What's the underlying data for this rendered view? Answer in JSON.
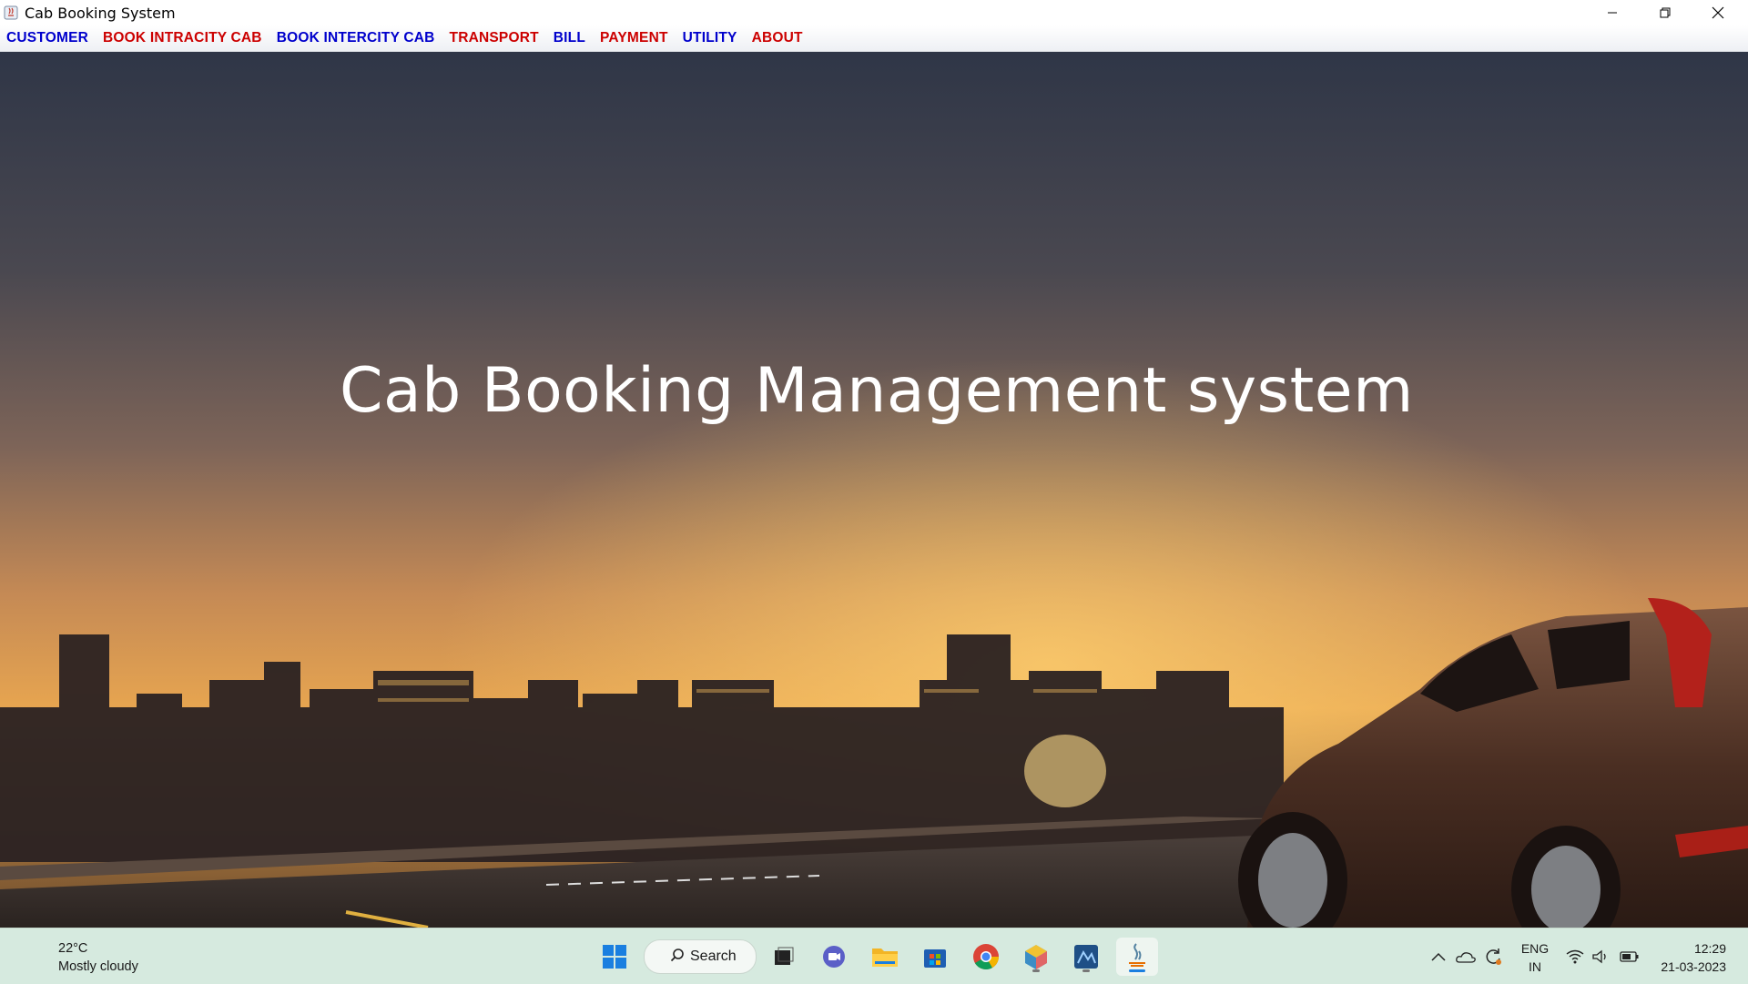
{
  "window": {
    "title": "Cab Booking System"
  },
  "menu": [
    {
      "label": "CUSTOMER",
      "color": "#0000cc"
    },
    {
      "label": "BOOK INTRACITY CAB",
      "color": "#cc0000"
    },
    {
      "label": "BOOK INTERCITY CAB",
      "color": "#0000cc"
    },
    {
      "label": "TRANSPORT",
      "color": "#cc0000"
    },
    {
      "label": "BILL",
      "color": "#0000cc"
    },
    {
      "label": "PAYMENT",
      "color": "#cc0000"
    },
    {
      "label": "UTILITY",
      "color": "#0000cc"
    },
    {
      "label": "ABOUT",
      "color": "#cc0000"
    }
  ],
  "main": {
    "heading": "Cab Booking Management system"
  },
  "taskbar": {
    "weather": {
      "temp": "22°C",
      "condition": "Mostly cloudy"
    },
    "search_label": "Search",
    "apps": [
      "start-icon",
      "task-view-icon",
      "chat-icon",
      "file-explorer-icon",
      "store-icon",
      "chrome-icon",
      "cube-app-icon",
      "ide-app-icon",
      "java-app-icon"
    ],
    "tray": {
      "lang_line1": "ENG",
      "lang_line2": "IN",
      "time": "12:29",
      "date": "21-03-2023"
    }
  }
}
